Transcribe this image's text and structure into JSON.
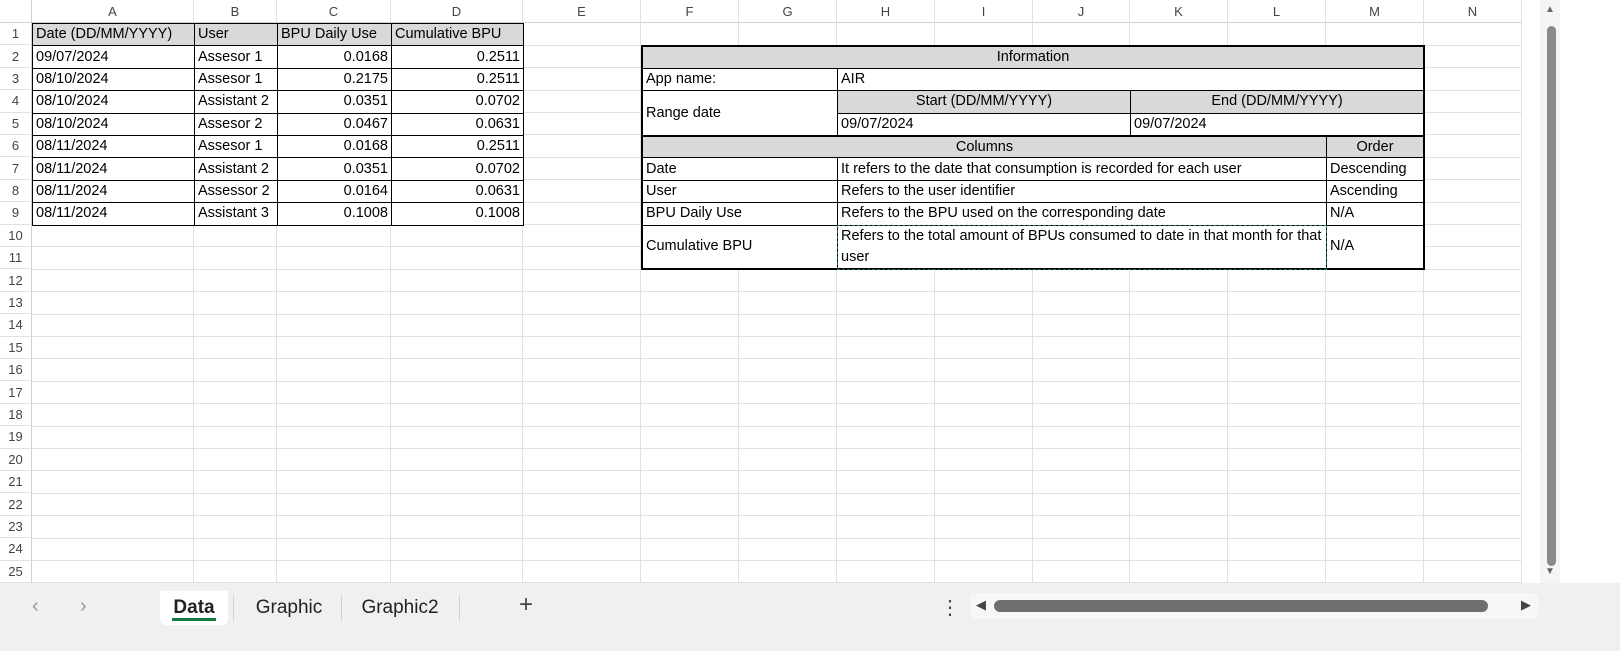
{
  "columns": [
    "A",
    "B",
    "C",
    "D",
    "E",
    "F",
    "G",
    "H",
    "I",
    "J",
    "K",
    "L",
    "M",
    "N"
  ],
  "row_count": 25,
  "data_table": {
    "headers": [
      "Date (DD/MM/YYYY)",
      "User",
      "BPU Daily Use",
      "Cumulative BPU"
    ],
    "rows": [
      [
        "09/07/2024",
        "Assesor 1",
        "0.0168",
        "0.2511"
      ],
      [
        "08/10/2024",
        "Assesor 1",
        "0.2175",
        "0.2511"
      ],
      [
        "08/10/2024",
        "Assistant 2",
        "0.0351",
        "0.0702"
      ],
      [
        "08/10/2024",
        "Assesor 2",
        "0.0467",
        "0.0631"
      ],
      [
        "08/11/2024",
        "Assesor 1",
        "0.0168",
        "0.2511"
      ],
      [
        "08/11/2024",
        "Assistant 2",
        "0.0351",
        "0.0702"
      ],
      [
        "08/11/2024",
        "Assessor 2",
        "0.0164",
        "0.0631"
      ],
      [
        "08/11/2024",
        "Assistant 3",
        "0.1008",
        "0.1008"
      ]
    ]
  },
  "info_table": {
    "title": "Information",
    "app_name_label": "App name:",
    "app_name_value": "AIR",
    "range_label": "Range date",
    "start_label": "Start (DD/MM/YYYY)",
    "end_label": "End (DD/MM/YYYY)",
    "start_value": "09/07/2024",
    "end_value": "09/07/2024",
    "columns_label": "Columns",
    "order_label": "Order",
    "rows": [
      {
        "name": "Date",
        "description": "It refers to the date that consumption is recorded for each user",
        "order": "Descending"
      },
      {
        "name": "User",
        "description": "Refers to the user identifier",
        "order": "Ascending"
      },
      {
        "name": "BPU Daily Use",
        "description": "Refers to the BPU used on the corresponding date",
        "order": "N/A"
      },
      {
        "name": "Cumulative BPU",
        "description": "Refers to the total amount of BPUs consumed to date in that month for that user",
        "order": "N/A"
      }
    ]
  },
  "selection_color": "#1e7145",
  "sheet_tabs": [
    {
      "label": "Data",
      "active": true
    },
    {
      "label": "Graphic",
      "active": false
    },
    {
      "label": "Graphic2",
      "active": false
    }
  ],
  "icons": {
    "prev": "‹",
    "next": "›",
    "add": "+",
    "more": "⋮",
    "scroll_left": "◀",
    "scroll_right": "▶",
    "scroll_up": "▲",
    "scroll_down": "▼"
  }
}
